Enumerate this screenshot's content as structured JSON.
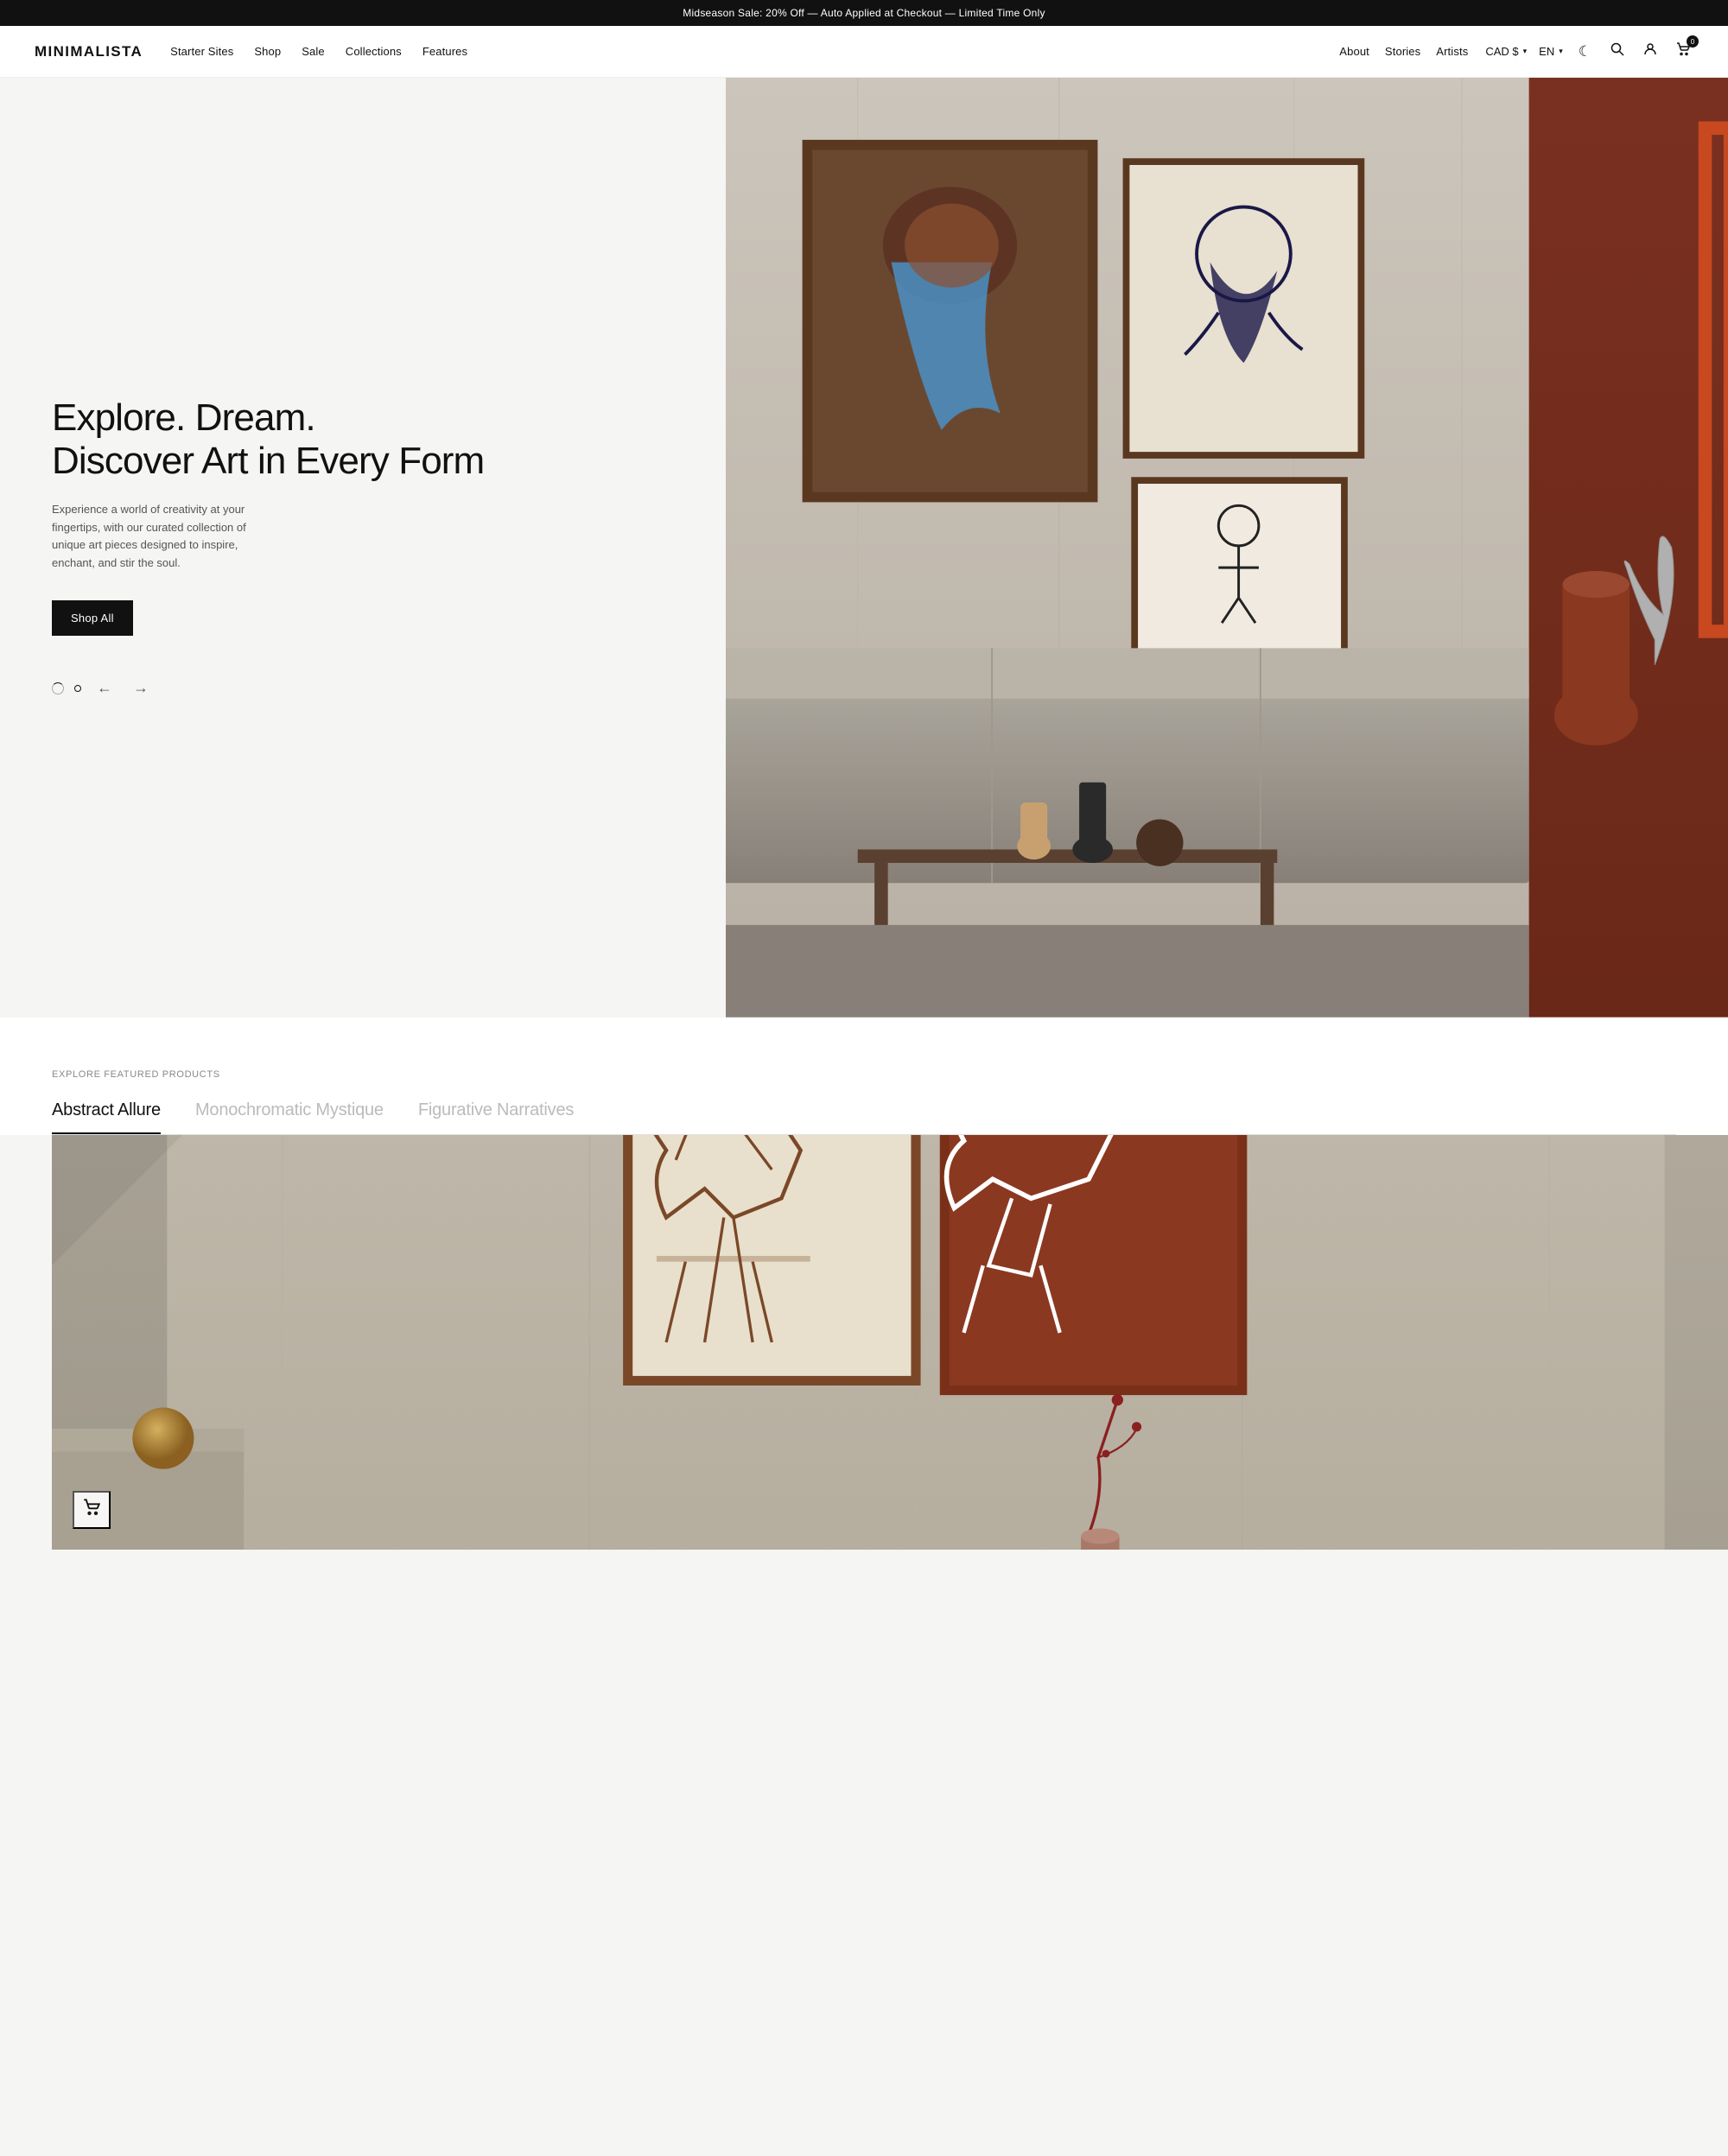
{
  "announcement": {
    "text": "Midseason Sale: 20% Off — Auto Applied at Checkout — Limited Time Only"
  },
  "header": {
    "logo": "MINIMALISTA",
    "nav_main": [
      {
        "label": "Starter Sites",
        "href": "#"
      },
      {
        "label": "Shop",
        "href": "#"
      },
      {
        "label": "Sale",
        "href": "#"
      },
      {
        "label": "Collections",
        "href": "#"
      },
      {
        "label": "Features",
        "href": "#"
      }
    ],
    "nav_right": [
      {
        "label": "About",
        "href": "#"
      },
      {
        "label": "Stories",
        "href": "#"
      },
      {
        "label": "Artists",
        "href": "#"
      }
    ],
    "currency": "CAD $",
    "language": "EN",
    "cart_count": "0"
  },
  "hero": {
    "title": "Explore. Dream.\nDiscover Art in Every Form",
    "description": "Experience a world of creativity at your fingertips, with our curated collection of unique art pieces designed to inspire, enchant, and stir the soul.",
    "cta_label": "Shop All",
    "slides_count": 2,
    "active_slide": 0
  },
  "featured": {
    "label": "Explore Featured Products",
    "tabs": [
      {
        "label": "Abstract Allure",
        "active": true
      },
      {
        "label": "Monochromatic Mystique",
        "active": false
      },
      {
        "label": "Figurative Narratives",
        "active": false
      }
    ]
  },
  "icons": {
    "moon": "☾",
    "search": "🔍",
    "user": "👤",
    "cart": "🛍",
    "chevron_down": "▾",
    "arrow_left": "←",
    "arrow_right": "→",
    "cart_float": "🛒"
  }
}
